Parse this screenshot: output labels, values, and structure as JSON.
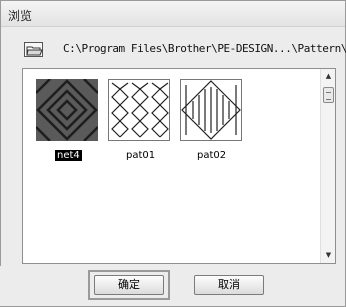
{
  "window": {
    "title": "浏览"
  },
  "location": {
    "folder_icon": "open-folder-icon",
    "path": "C:\\Program Files\\Brother\\PE-DESIGN...\\Pattern\\"
  },
  "items": [
    {
      "label": "net4",
      "selected": true,
      "icon": "net4-pattern-thumbnail"
    },
    {
      "label": "pat01",
      "selected": false,
      "icon": "pat01-pattern-thumbnail"
    },
    {
      "label": "pat02",
      "selected": false,
      "icon": "pat02-pattern-thumbnail"
    }
  ],
  "scrollbar": {
    "up_icon": "scroll-up-arrow-icon",
    "down_icon": "scroll-down-arrow-icon"
  },
  "buttons": {
    "ok": "确定",
    "cancel": "取消"
  }
}
